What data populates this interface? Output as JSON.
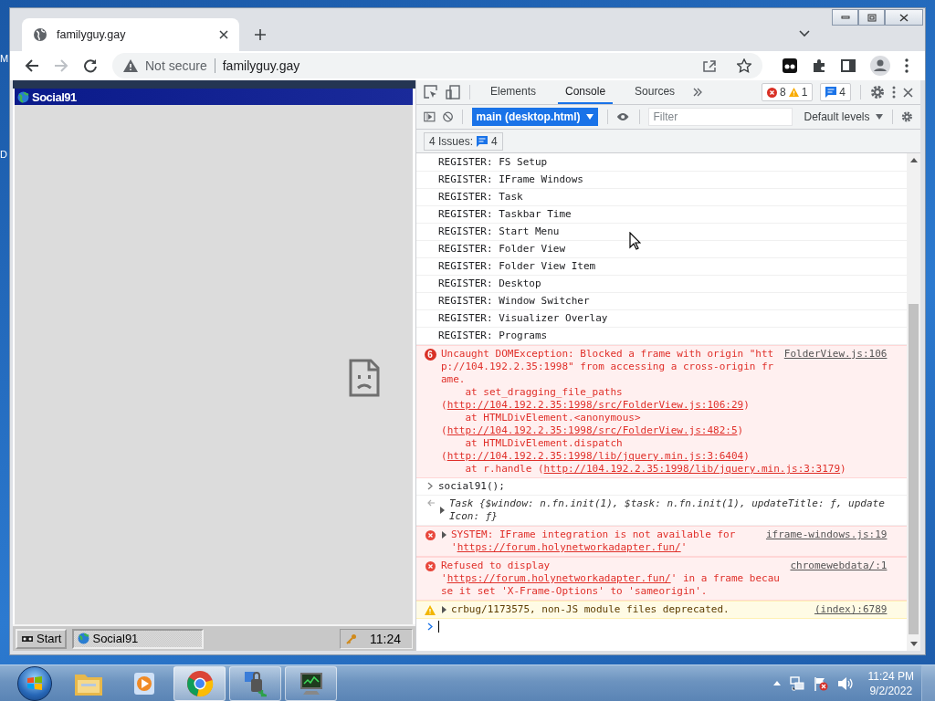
{
  "desktop_fragments": [
    "M",
    "D"
  ],
  "browser": {
    "tab": {
      "title": "familyguy.gay"
    },
    "nav": [
      {
        "kind": "back",
        "disabled": false
      },
      {
        "kind": "forward",
        "disabled": true
      },
      {
        "kind": "reload",
        "disabled": false
      }
    ],
    "omnibox": {
      "security": "Not secure",
      "url": "familyguy.gay"
    }
  },
  "page": {
    "window_title": "Social91",
    "start": "Start",
    "tasks": [
      {
        "label": "Social91",
        "selected": true
      }
    ],
    "clock": "11:24"
  },
  "devtools": {
    "tabs": [
      {
        "label": "Elements",
        "selected": false
      },
      {
        "label": "Console",
        "selected": true
      },
      {
        "label": "Sources",
        "selected": false
      }
    ],
    "counts": {
      "errors": "8",
      "warnings": "1",
      "messages": "4"
    },
    "context": "main (desktop.html)",
    "filter": {
      "placeholder": "Filter"
    },
    "levels": "Default levels",
    "issues": {
      "label": "4 Issues:",
      "count": "4"
    },
    "messages": [
      {
        "kind": "log",
        "text": "REGISTER: FS Setup"
      },
      {
        "kind": "log",
        "text": "REGISTER: IFrame Windows"
      },
      {
        "kind": "log",
        "text": "REGISTER: Task"
      },
      {
        "kind": "log",
        "text": "REGISTER: Taskbar Time"
      },
      {
        "kind": "log",
        "text": "REGISTER: Start Menu"
      },
      {
        "kind": "log",
        "text": "REGISTER: Folder View"
      },
      {
        "kind": "log",
        "text": "REGISTER: Folder View Item"
      },
      {
        "kind": "log",
        "text": "REGISTER: Desktop"
      },
      {
        "kind": "log",
        "text": "REGISTER: Window Switcher"
      },
      {
        "kind": "log",
        "text": "REGISTER: Visualizer Overlay"
      },
      {
        "kind": "log",
        "text": "REGISTER: Programs"
      },
      {
        "kind": "error",
        "count": "6",
        "text": "Uncaught DOMException: Blocked a frame with origin \"http://104.192.2.35:1998\" from accessing a cross-origin frame.",
        "source": "FolderView.js:106",
        "stack": [
          {
            "call": "at set_dragging_file_paths (",
            "url": "http://104.192.2.35:1998/src/FolderView.js:106:29",
            "end": ")"
          },
          {
            "call": "at HTMLDivElement.<anonymous> (",
            "url": "http://104.192.2.35:1998/src/FolderView.js:482:5",
            "end": ")"
          },
          {
            "call": "at HTMLDivElement.dispatch (",
            "url": "http://104.192.2.35:1998/lib/jquery.min.js:3:6404",
            "end": ")"
          },
          {
            "call": "at r.handle (",
            "url": "http://104.192.2.35:1998/lib/jquery.min.js:3:3179",
            "end": ")"
          }
        ]
      },
      {
        "kind": "input",
        "text": "social91();"
      },
      {
        "kind": "result",
        "expanded": false,
        "text": "Task {$window: n.fn.init(1), $task: n.fn.init(1), updateTitle: ƒ, updateIcon: ƒ}"
      },
      {
        "kind": "error",
        "expanded": false,
        "text": "SYSTEM: IFrame integration is not available for '",
        "link": "https://forum.holynetworkadapter.fun/",
        "after": "'",
        "source": "iframe-windows.js:19"
      },
      {
        "kind": "error",
        "text": "Refused to display '",
        "link": "https://forum.holynetworkadapter.fun/",
        "after": "' in a frame because it set 'X-Frame-Options' to 'sameorigin'.",
        "source": "chromewebdata/:1"
      },
      {
        "kind": "warning",
        "expanded": false,
        "text": "crbug/1173575, non-JS module files deprecated.",
        "source": "(index):6789"
      },
      {
        "kind": "prompt"
      }
    ]
  },
  "taskbar": {
    "apps": [
      {
        "kind": "folder",
        "running": false,
        "selected": false
      },
      {
        "kind": "media",
        "running": false,
        "selected": false
      },
      {
        "kind": "chrome",
        "running": true,
        "selected": true
      },
      {
        "kind": "network",
        "running": true,
        "selected": false
      },
      {
        "kind": "monitor",
        "running": true,
        "selected": false
      }
    ],
    "time": "11:24 PM",
    "date": "9/2/2022"
  }
}
